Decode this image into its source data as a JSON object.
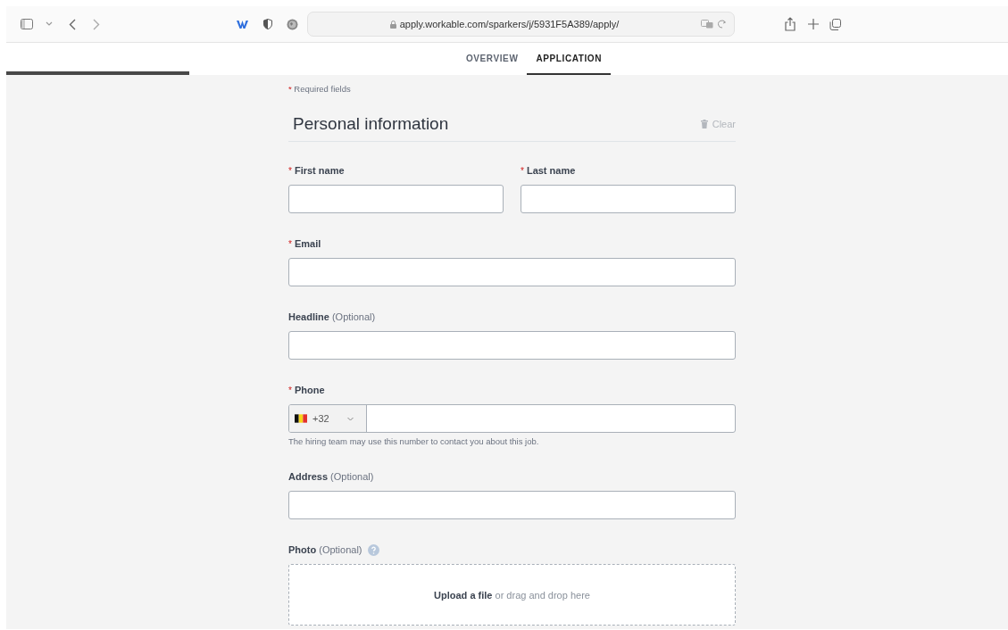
{
  "browser": {
    "url": "apply.workable.com/sparkers/j/5931F5A389/apply/",
    "loading": {
      "level": 0.183
    }
  },
  "tabs": [
    {
      "label": "OVERVIEW",
      "selected": false
    },
    {
      "label": "APPLICATION",
      "selected": true
    }
  ],
  "required_note": {
    "mark": "*",
    "text": "Required fields"
  },
  "section": {
    "title": "Personal information",
    "clear": "Clear"
  },
  "rows": [
    [
      {
        "kind": "text",
        "required_mark": "*",
        "label": "First name"
      },
      {
        "kind": "text",
        "required_mark": "*",
        "label": "Last name"
      }
    ],
    [
      {
        "kind": "text",
        "required_mark": "*",
        "label": "Email"
      }
    ],
    [
      {
        "kind": "text",
        "label": "**Headline** (Optional)"
      }
    ],
    [
      {
        "kind": "phone",
        "required_mark": "*",
        "label": "Phone",
        "country_code": "+32",
        "hint": "The hiring team may use this number to contact you about this job."
      }
    ],
    [
      {
        "kind": "text",
        "label": "**Address** (Optional)"
      }
    ],
    [
      {
        "kind": "upload",
        "label": "**Photo** (Optional)",
        "help": true,
        "drop_text": "**Upload a file** or drag and drop here"
      }
    ]
  ]
}
